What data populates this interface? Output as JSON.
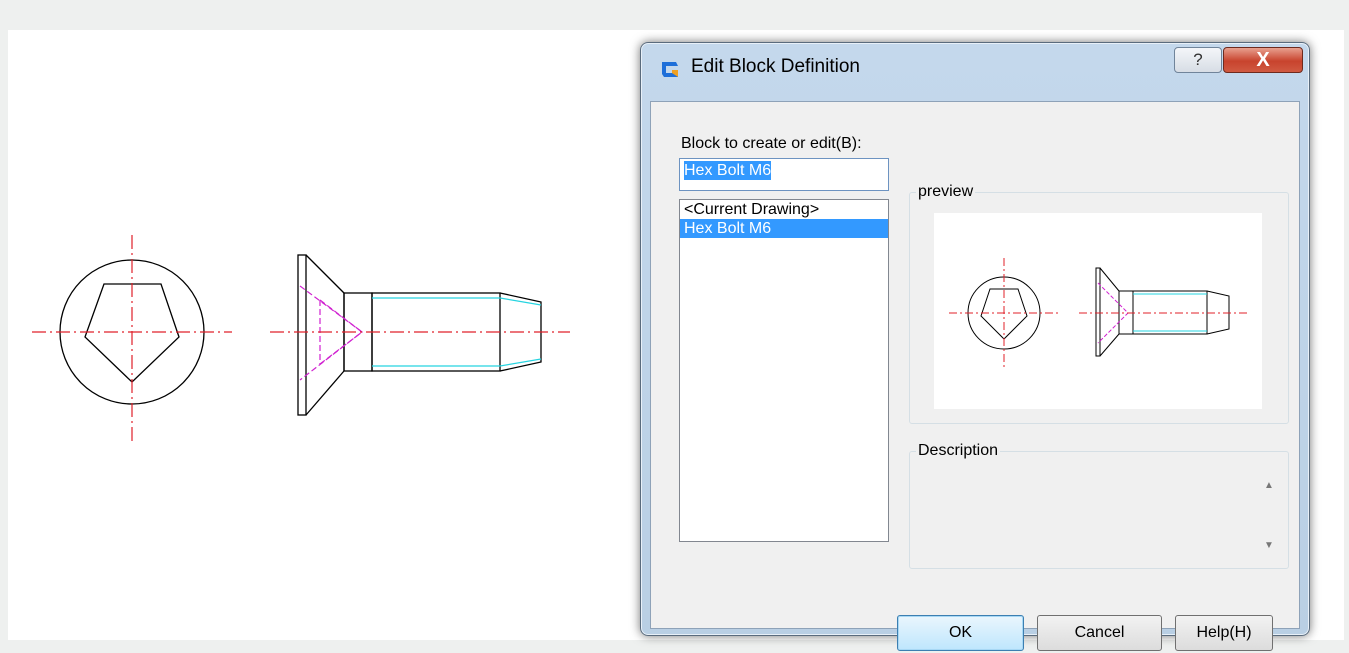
{
  "dialog": {
    "title": "Edit Block Definition",
    "help_glyph": "?",
    "close_glyph": "X",
    "block_label": "Block to create or edit(B):",
    "block_value": "Hex Bolt M6",
    "list_items": [
      "<Current Drawing>",
      "Hex Bolt M6"
    ],
    "selected_index": 1,
    "preview_label": "preview",
    "description_label": "Description",
    "description_value": "",
    "buttons": {
      "ok": "OK",
      "cancel": "Cancel",
      "help": "Help(H)"
    }
  },
  "icons": {
    "app": "gstarcad-logo-icon",
    "help": "question-icon",
    "close": "close-icon",
    "scroll_up": "scroll-up-arrow-icon",
    "scroll_down": "scroll-down-arrow-icon"
  },
  "colors": {
    "centerline": "#e0202a",
    "hidden_line": "#d020d0",
    "thread_line": "#26d4e0",
    "outline": "#000000",
    "selection": "#3399ff",
    "close_button": "#c8432d"
  }
}
